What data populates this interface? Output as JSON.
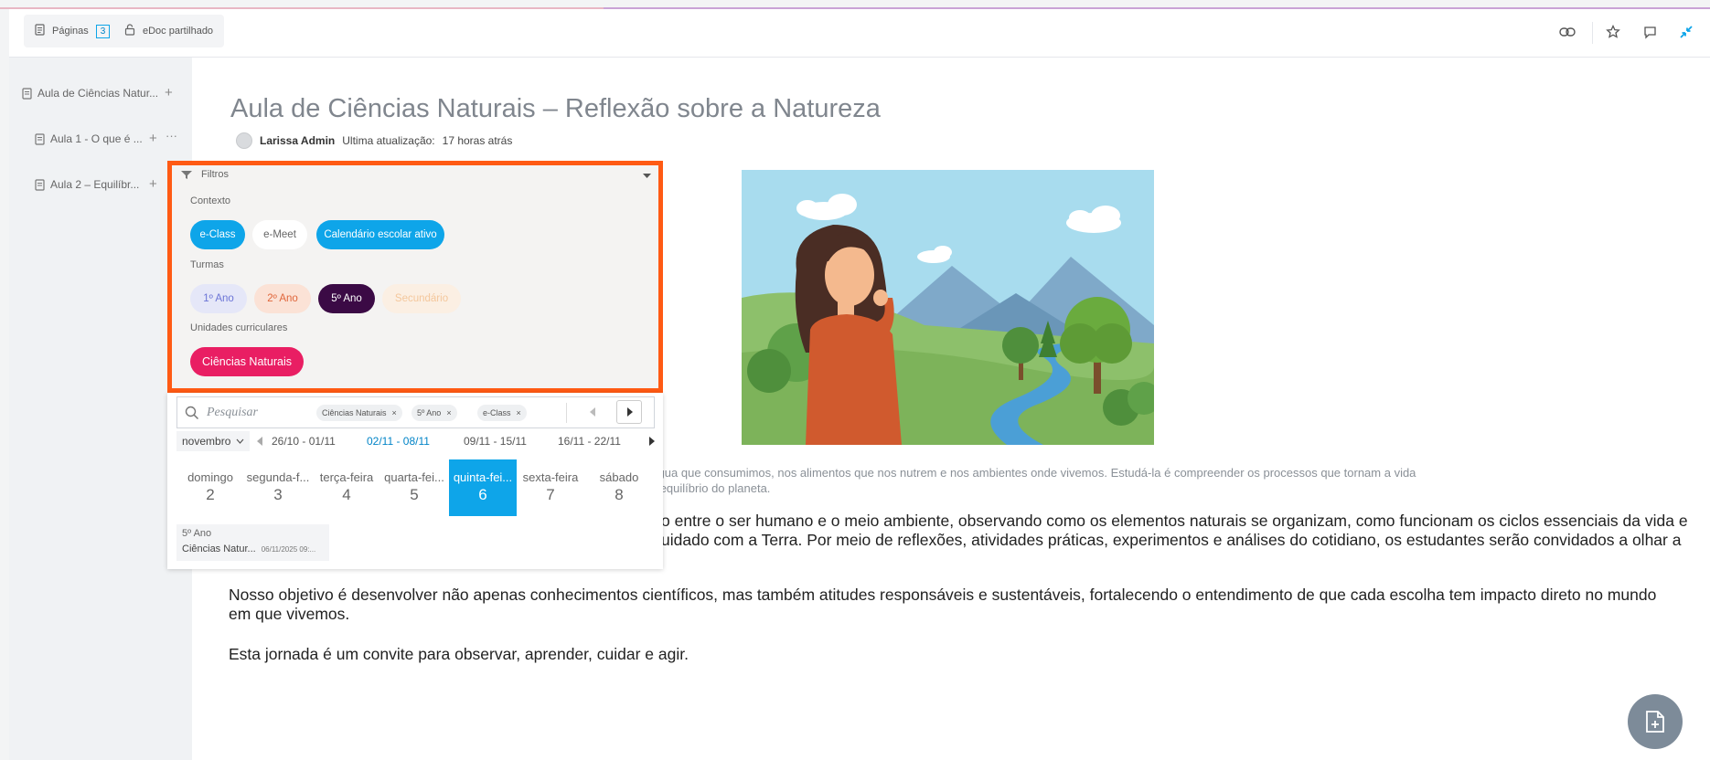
{
  "topbar": {
    "pages_label": "Páginas",
    "pages_count": "3",
    "shared_label": "eDoc partilhado"
  },
  "sidebar": {
    "items": [
      {
        "label": "Aula de Ciências Natur..."
      },
      {
        "label": "Aula 1 - O que é ..."
      },
      {
        "label": "Aula 2 – Equilíbr..."
      }
    ]
  },
  "document": {
    "title": "Aula de Ciências Naturais – Reflexão sobre a Natureza",
    "author": "Larissa Admin",
    "updated_label": "Ultima atualização:",
    "updated_value": "17 horas atrás",
    "caption_line1": "presente no ar que respiramos, na água que consumimos, nos alimentos que nos nutrem e nos ambientes onde vivemos. Estudá-la é compreender os processos que tornam a vida",
    "caption_line2": "bre como nossas ações impactam o equilíbrio do planeta.",
    "para1_line1": "o entre o ser humano e o meio ambiente, observando como os elementos naturais se organizam, como funcionam os ciclos essenciais da vida e",
    "para1_line2": "uidado com a Terra. Por meio de reflexões, atividades práticas, experimentos e análises do cotidiano, os estudantes serão convidados a olhar a",
    "para2": "Nosso objetivo é desenvolver não apenas conhecimentos científicos, mas também atitudes responsáveis e sustentáveis, fortalecendo o entendimento de que cada escolha tem impacto direto no mundo em que vivemos.",
    "para3": "Esta jornada é um convite para observar, aprender, cuidar e agir."
  },
  "filters": {
    "header": "Filtros",
    "context_label": "Contexto",
    "context_chips": [
      "e-Class",
      "e-Meet",
      "Calendário escolar ativo"
    ],
    "classes_label": "Turmas",
    "class_chips": [
      "1º Ano",
      "2º Ano",
      "5º Ano",
      "Secundário"
    ],
    "units_label": "Unidades curriculares",
    "unit_chips": [
      "Ciências Naturais"
    ]
  },
  "calendar": {
    "search_placeholder": "Pesquisar",
    "tags": [
      "Ciências Naturais",
      "5º Ano",
      "e-Class"
    ],
    "month": "novembro",
    "weeks": [
      "26/10 - 01/11",
      "02/11 - 08/11",
      "09/11 - 15/11",
      "16/11 - 22/11"
    ],
    "active_week": 1,
    "days": [
      {
        "name": "domingo",
        "num": "2"
      },
      {
        "name": "segunda-f...",
        "num": "3"
      },
      {
        "name": "terça-feira",
        "num": "4"
      },
      {
        "name": "quarta-fei...",
        "num": "5"
      },
      {
        "name": "quinta-fei...",
        "num": "6"
      },
      {
        "name": "sexta-feira",
        "num": "7"
      },
      {
        "name": "sábado",
        "num": "8"
      }
    ],
    "active_day": 4,
    "event": {
      "class": "5º Ano",
      "title": "Ciências Natur...",
      "date": "06/11/2025 09:..."
    }
  },
  "colors": {
    "accent": "#0ea5e9",
    "highlight_border": "#ff5a14",
    "unit_chip": "#e91e63",
    "class_5": "#3b0a45"
  }
}
